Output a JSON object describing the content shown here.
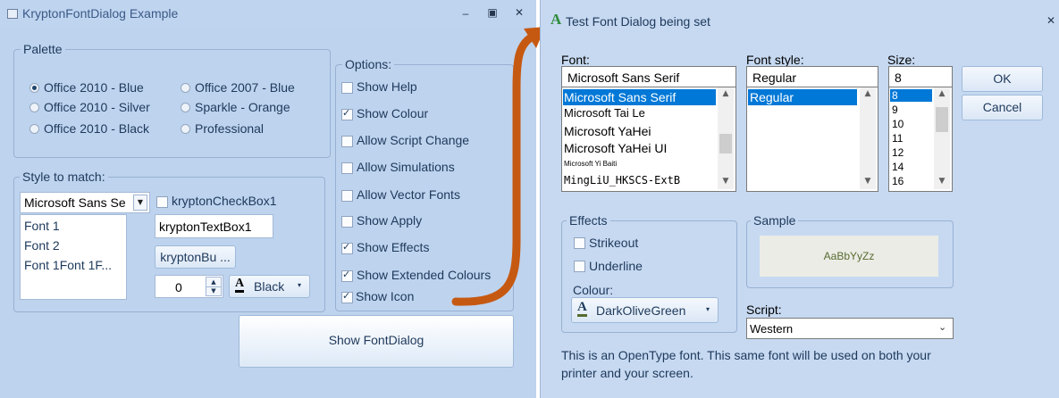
{
  "windowA": {
    "title": "KryptonFontDialog Example",
    "controls": [
      "‒",
      "▣",
      "✕"
    ],
    "palette": {
      "legend": "Palette",
      "options": [
        "Office 2010 - Blue",
        "Office 2010 - Silver",
        "Office 2010 - Black",
        "Office 2007 - Blue",
        "Sparkle - Orange",
        "Professional"
      ],
      "selected": "Office 2010 - Blue"
    },
    "options": {
      "legend": "Options:",
      "items": [
        {
          "label": "Show Help",
          "checked": false
        },
        {
          "label": "Show Colour",
          "checked": true
        },
        {
          "label": "Allow Script Change",
          "checked": false
        },
        {
          "label": "Allow Simulations",
          "checked": false
        },
        {
          "label": "Allow Vector Fonts",
          "checked": false
        },
        {
          "label": "Show Apply",
          "checked": false
        },
        {
          "label": "Show Effects",
          "checked": true
        },
        {
          "label": "Show Extended Colours",
          "checked": true
        },
        {
          "label": "Show Icon",
          "checked": true
        }
      ]
    },
    "style": {
      "legend": "Style to match:",
      "combo_value": "Microsoft Sans Se",
      "list_items": [
        "Font 1",
        "Font 2",
        "Font 1Font 1F..."
      ],
      "checkbox_label": "kryptonCheckBox1",
      "textbox_value": "kryptonTextBox1",
      "button_label": "kryptonBu ...",
      "numeric_value": "0",
      "colour_label": "Black"
    },
    "show_button": "Show FontDialog"
  },
  "dialog": {
    "title": "Test Font Dialog being set",
    "font": {
      "label": "Font:",
      "value": "Microsoft Sans Serif",
      "items": [
        "Microsoft Sans Serif",
        "Microsoft Tai Le",
        "Microsoft YaHei",
        "Microsoft YaHei UI",
        "Microsoft Yi Baiti",
        "MingLiU_HKSCS-ExtB"
      ]
    },
    "style": {
      "label": "Font style:",
      "value": "Regular",
      "items": [
        "Regular"
      ]
    },
    "size": {
      "label": "Size:",
      "value": "8",
      "items": [
        "8",
        "9",
        "10",
        "11",
        "12",
        "14",
        "16"
      ]
    },
    "ok": "OK",
    "cancel": "Cancel",
    "effects": {
      "legend": "Effects",
      "strikeout": "Strikeout",
      "underline": "Underline",
      "colour_label": "Colour:",
      "colour_value": "DarkOliveGreen"
    },
    "sample": {
      "legend": "Sample",
      "text": "AaBbYyZz"
    },
    "script": {
      "label": "Script:",
      "value": "Western"
    },
    "description": "This is an OpenType font. This same font will be used on both your printer and your screen."
  }
}
